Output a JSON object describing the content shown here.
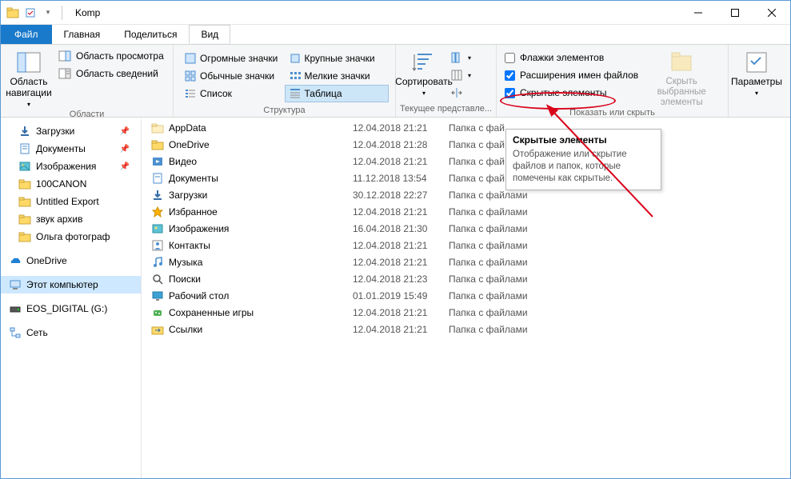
{
  "window": {
    "title": "Komp"
  },
  "tabs": {
    "file": "Файл",
    "home": "Главная",
    "share": "Поделиться",
    "view": "Вид"
  },
  "ribbon": {
    "areas": {
      "navpane": "Область\nнавигации",
      "preview": "Область просмотра",
      "details": "Область сведений",
      "caption": "Области"
    },
    "layout": {
      "xl": "Огромные значки",
      "lg": "Крупные значки",
      "md": "Обычные значки",
      "sm": "Мелкие значки",
      "list": "Список",
      "table": "Таблица",
      "caption": "Структура"
    },
    "current": {
      "sort": "Сортировать",
      "caption": "Текущее представле..."
    },
    "showhide": {
      "checkboxes": "Флажки элементов",
      "extensions": "Расширения имен файлов",
      "hidden": "Скрытые элементы",
      "hidesel": "Скрыть выбранные\nэлементы",
      "caption": "Показать или скрыть"
    },
    "options": "Параметры"
  },
  "nav": {
    "downloads": "Загрузки",
    "documents": "Документы",
    "pictures": "Изображения",
    "canon": "100CANON",
    "untitled": "Untitled Export",
    "sound": "звук архив",
    "olga": "Ольга фотограф",
    "onedrive": "OneDrive",
    "thispc": "Этот компьютер",
    "eos": "EOS_DIGITAL (G:)",
    "network": "Сеть"
  },
  "files": [
    {
      "name": "AppData",
      "date": "12.04.2018 21:21",
      "type": "Папка с фай"
    },
    {
      "name": "OneDrive",
      "date": "12.04.2018 21:28",
      "type": "Папка с фай"
    },
    {
      "name": "Видео",
      "date": "12.04.2018 21:21",
      "type": "Папка с фай"
    },
    {
      "name": "Документы",
      "date": "11.12.2018 13:54",
      "type": "Папка с фай"
    },
    {
      "name": "Загрузки",
      "date": "30.12.2018 22:27",
      "type": "Папка с файлами"
    },
    {
      "name": "Избранное",
      "date": "12.04.2018 21:21",
      "type": "Папка с файлами"
    },
    {
      "name": "Изображения",
      "date": "16.04.2018 21:30",
      "type": "Папка с файлами"
    },
    {
      "name": "Контакты",
      "date": "12.04.2018 21:21",
      "type": "Папка с файлами"
    },
    {
      "name": "Музыка",
      "date": "12.04.2018 21:21",
      "type": "Папка с файлами"
    },
    {
      "name": "Поиски",
      "date": "12.04.2018 21:23",
      "type": "Папка с файлами"
    },
    {
      "name": "Рабочий стол",
      "date": "01.01.2019 15:49",
      "type": "Папка с файлами"
    },
    {
      "name": "Сохраненные игры",
      "date": "12.04.2018 21:21",
      "type": "Папка с файлами"
    },
    {
      "name": "Ссылки",
      "date": "12.04.2018 21:21",
      "type": "Папка с файлами"
    }
  ],
  "tooltip": {
    "title": "Скрытые элементы",
    "body": "Отображение или скрытие файлов и папок, которые помечены как скрытые."
  }
}
